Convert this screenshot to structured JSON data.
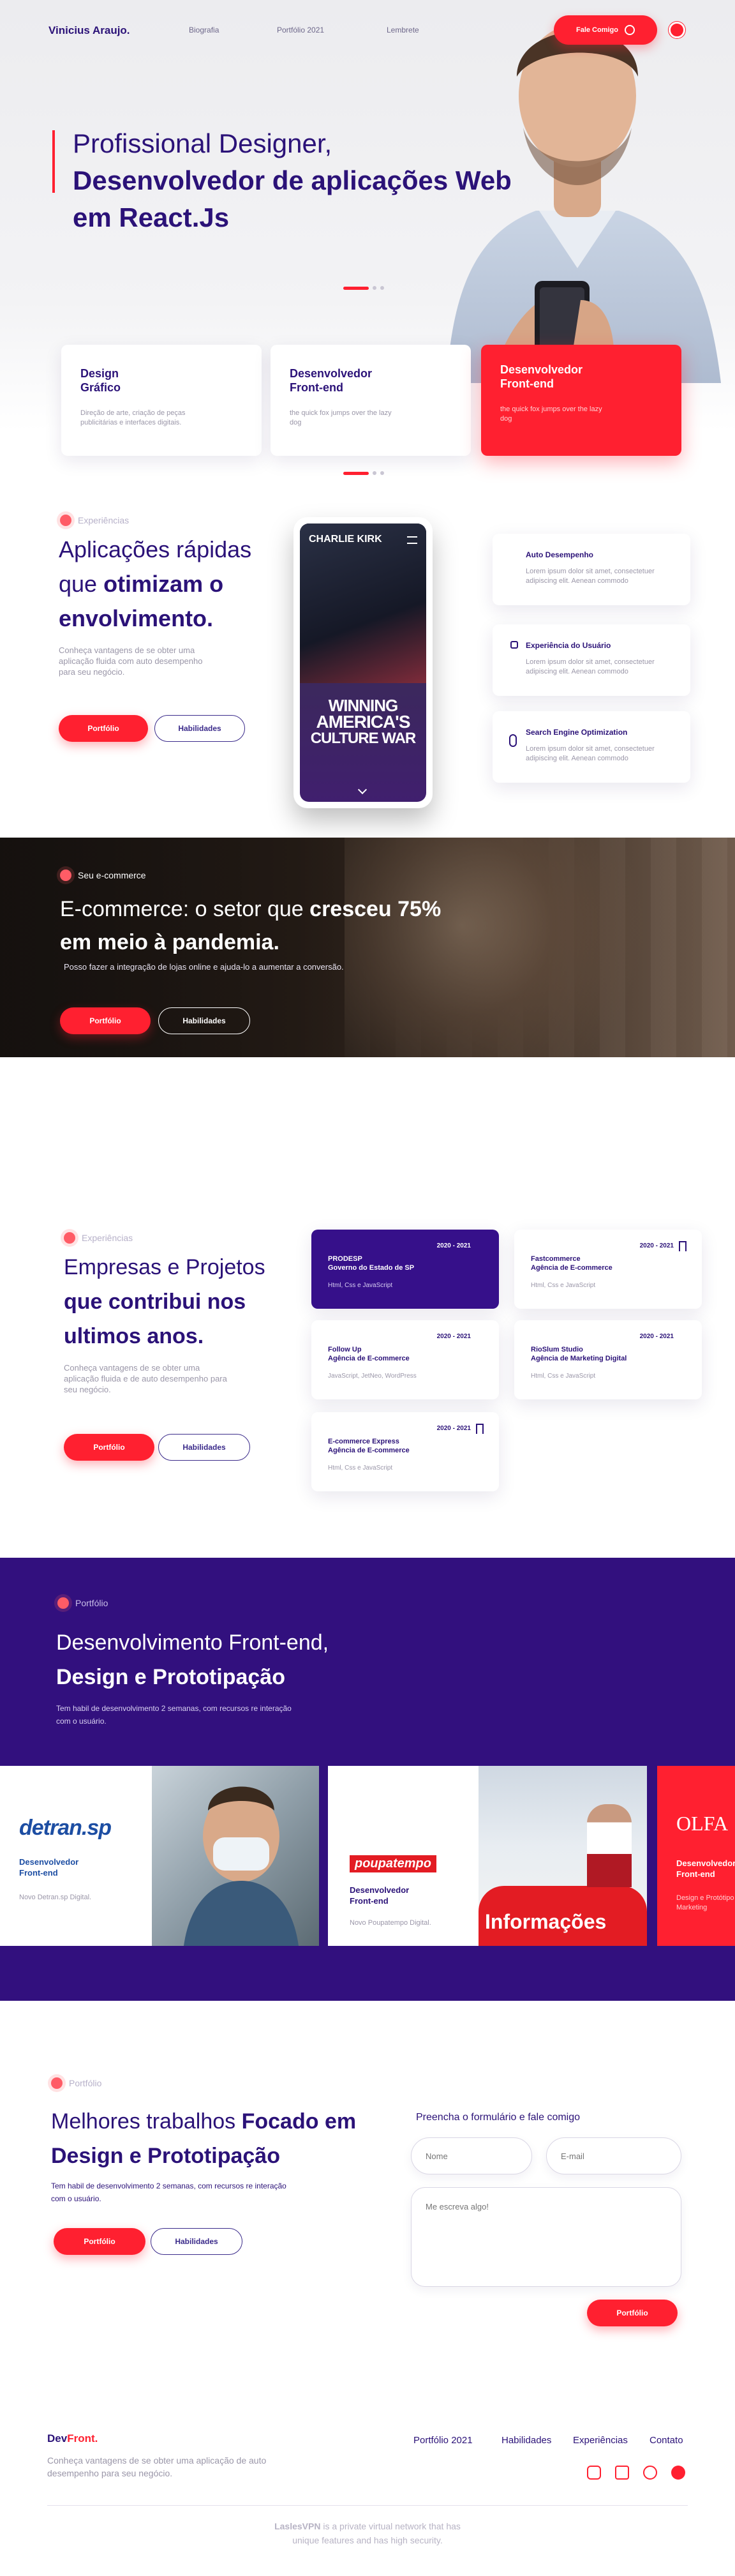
{
  "nav": {
    "brand": "Vinicius Araujo.",
    "links": [
      "Biografia",
      "Portfólio 2021",
      "Lembrete"
    ],
    "cta": "Fale Comigo"
  },
  "hero": {
    "title_line1": "Profissional Designer,",
    "title_line2": "Desenvolvedor de aplicações Web",
    "title_line3": "em React.Js",
    "cards": [
      {
        "title1": "Design",
        "title2": "Gráfico",
        "text": "Direção de arte, criação de peças publicitárias e interfaces digitais."
      },
      {
        "title1": "Desenvolvedor",
        "title2": "Front-end",
        "text": "the quick fox jumps over the lazy dog"
      },
      {
        "title1": "Desenvolvedor",
        "title2": "Front-end",
        "text": "the quick fox jumps over the lazy dog"
      }
    ]
  },
  "apps": {
    "eyebrow": "Experiências",
    "title_light1": "Aplicações rápidas",
    "title_light2": "que ",
    "title_bold2": "otimizam o",
    "title_bold3": "envolvimento.",
    "text": "Conheça vantagens de se obter uma aplicação fluida com auto desempenho para seu negócio.",
    "btn_portfolio": "Portfólio",
    "btn_skills": "Habilidades",
    "phone": {
      "top": "CHARLIE KIRK",
      "line1": "WINNING",
      "line2": "AMERICA'S",
      "line3": "CULTURE WAR"
    },
    "features": [
      {
        "title": "Auto Desempenho",
        "text": "Lorem ipsum dolor sit amet, consectetuer adipiscing elit. Aenean commodo"
      },
      {
        "title": "Experiência do Usuário",
        "text": "Lorem ipsum dolor sit amet, consectetuer adipiscing elit. Aenean commodo"
      },
      {
        "title": "Search Engine Optimization",
        "text": "Lorem ipsum dolor sit amet, consectetuer adipiscing elit. Aenean commodo"
      }
    ]
  },
  "ecommerce": {
    "eyebrow": "Seu e-commerce",
    "title_light": "E-commerce: o setor que ",
    "title_bold1": "cresceu 75%",
    "title_bold2": "em meio à pandemia.",
    "text": "Posso fazer a integração de lojas online e ajuda-lo a aumentar a conversão.",
    "btn_portfolio": "Portfólio",
    "btn_skills": "Habilidades"
  },
  "companies": {
    "eyebrow": "Experiências",
    "title_light": "Empresas e Projetos",
    "title_bold1": "que contribui nos",
    "title_bold2": "ultimos anos.",
    "text": "Conheça vantagens de se obter uma aplicação fluida e de auto desempenho para seu negócio.",
    "btn_portfolio": "Portfólio",
    "btn_skills": "Habilidades",
    "jobs": [
      {
        "years": "2020 - 2021",
        "name": "PRODESP",
        "company": "Governo do Estado de SP",
        "stack": "Html, Css e JavaScript"
      },
      {
        "years": "2020 - 2021",
        "name": "Fastcommerce",
        "company": "Agência de E-commerce",
        "stack": "Html, Css e JavaScript"
      },
      {
        "years": "2020 - 2021",
        "name": "Follow Up",
        "company": "Agência de E-commerce",
        "stack": "JavaScript, JetNeo, WordPress"
      },
      {
        "years": "2020 - 2021",
        "name": "RioSlum Studio",
        "company": "Agência de Marketing Digital",
        "stack": "Html, Css e JavaScript"
      },
      {
        "years": "2020 - 2021",
        "name": "E-commerce Express",
        "company": "Agência de E-commerce",
        "stack": "Html, Css e JavaScript"
      }
    ]
  },
  "portfolio": {
    "eyebrow": "Portfólio",
    "title_light": "Desenvolvimento Front-end,",
    "title_bold": "Design e Prototipação",
    "text": "Tem habil de desenvolvimento 2 semanas, com recursos re interação com o usuário.",
    "items": [
      {
        "logo": "detran.sp",
        "role1": "Desenvolvedor",
        "role2": "Front-end",
        "desc": "Novo Detran.sp Digital."
      },
      {
        "logo": "poupatempo",
        "role1": "Desenvolvedor",
        "role2": "Front-end",
        "desc": "Novo Poupatempo Digital."
      },
      {
        "logo": "OLFA",
        "role1": "Desenvolvedor",
        "role2": "Front-end",
        "desc": "Design e Protótipo OLFATI Marketing"
      }
    ],
    "sign_text": "Informações"
  },
  "contact": {
    "eyebrow": "Portfólio",
    "title_light": "Melhores trabalhos ",
    "title_bold1": "Focado em",
    "title_bold2": "Design e Prototipação",
    "text": "Tem habil de desenvolvimento 2 semanas, com recursos re interação com o usuário.",
    "btn_portfolio": "Portfólio",
    "btn_skills": "Habilidades",
    "form_title": "Preencha o formulário e fale comigo",
    "name_placeholder": "Nome",
    "email_placeholder": "E-mail",
    "message_placeholder": "Me escreva algo!",
    "submit": "Portfólio"
  },
  "footer": {
    "brand_main": "Dev",
    "brand_accent": "Front.",
    "text": "Conheça vantagens de se obter uma aplicação de auto desempenho para seu negócio.",
    "links": [
      "Portfólio 2021",
      "Habilidades",
      "Experiências",
      "Contato"
    ],
    "bottom_bold": "LaslesVPN",
    "bottom_text": " is a private virtual network that has",
    "bottom_text2": "unique features and has high security."
  },
  "colors": {
    "red": "#ff2030",
    "purple": "#2b1278",
    "band": "#32107e"
  }
}
